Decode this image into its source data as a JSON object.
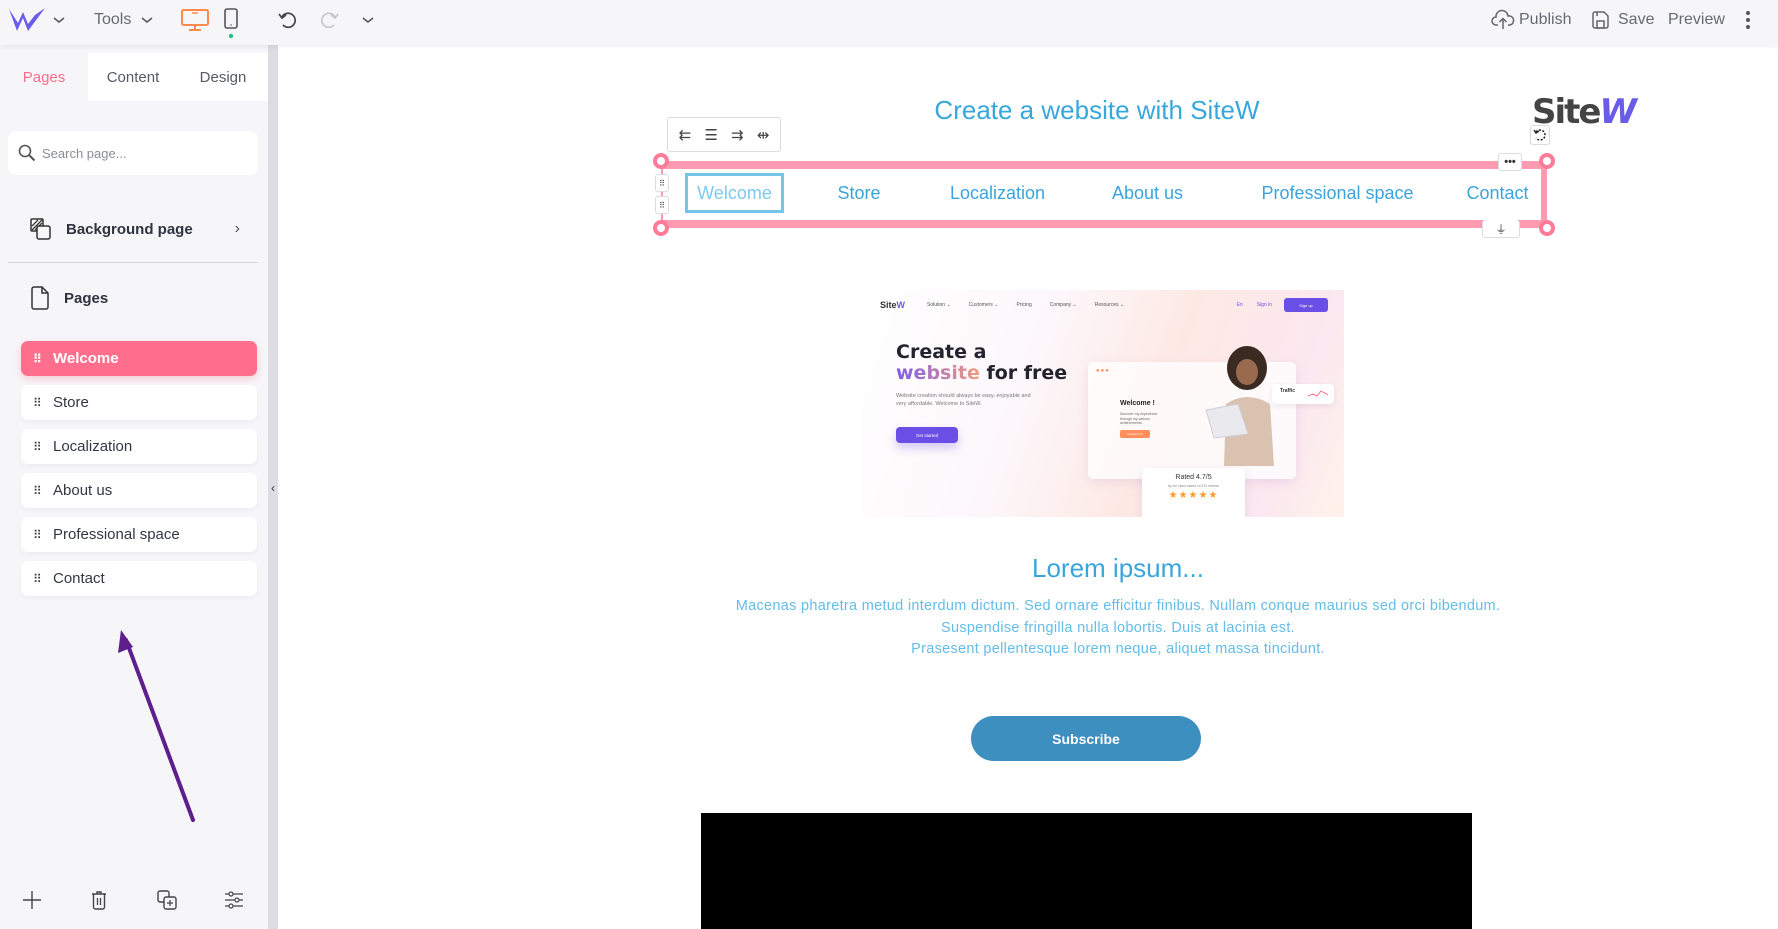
{
  "topbar": {
    "logo_icon": "sitew-w-logo",
    "tools_label": "Tools",
    "publish_label": "Publish",
    "save_label": "Save",
    "preview_label": "Preview",
    "active_device": "desktop",
    "colors": {
      "logo": "#6b5ce7",
      "desktop_active": "#ff8a4c",
      "mobile_dot": "#2dbd7e"
    }
  },
  "sidebar": {
    "tabs": [
      {
        "label": "Pages",
        "active": true
      },
      {
        "label": "Content",
        "active": false
      },
      {
        "label": "Design",
        "active": false
      }
    ],
    "search": {
      "placeholder": "Search page...",
      "value": ""
    },
    "background_page_label": "Background page",
    "pages_section_label": "Pages",
    "pages": [
      {
        "label": "Welcome",
        "active": true
      },
      {
        "label": "Store",
        "active": false
      },
      {
        "label": "Localization",
        "active": false
      },
      {
        "label": "About us",
        "active": false
      },
      {
        "label": "Professional space",
        "active": false
      },
      {
        "label": "Contact",
        "active": false
      }
    ],
    "bottom_tools": [
      "add-page-icon",
      "delete-icon",
      "duplicate-icon",
      "settings-sliders-icon"
    ],
    "accent_color": "#ff6e8c"
  },
  "canvas": {
    "site_title": "Create a website with SiteW",
    "logo_text_site": "Site",
    "logo_text_w": "W",
    "nav_links": [
      {
        "label": "Welcome",
        "active": true
      },
      {
        "label": "Store",
        "active": false
      },
      {
        "label": "Localization",
        "active": false
      },
      {
        "label": "About us",
        "active": false
      },
      {
        "label": "Professional space",
        "active": false
      },
      {
        "label": "Contact",
        "active": false
      }
    ],
    "hero": {
      "logo_site": "Site",
      "logo_w": "W",
      "menu": [
        "Solution ⌄",
        "Customers ⌄",
        "Pricing",
        "Company ⌄",
        "Resources ⌄"
      ],
      "lang": "En",
      "sign_in": "Sign in",
      "sign_up": "Sign up",
      "headline_line1": "Create a",
      "headline_grad": "website",
      "headline_rest": " for free",
      "subtext": "Website creation should always be easy, enjoyable and very affordable. Welcome to SiteW.",
      "cta": "Get started",
      "mock_welcome": "Welcome !",
      "mock_text": "Discover my experience through my various achievements.",
      "mock_button": "Contact me",
      "traffic_label": "Traffic",
      "rating_title": "Rated 4.7/5",
      "rating_sub": "by our users based on 913 reviews",
      "stars": "★★★★★"
    },
    "lorem_title": "Lorem ipsum...",
    "lorem_lines": [
      "Macenas pharetra metud interdum dictum. Sed ornare efficitur finibus. Nullam conque maurius sed orci bibendum.",
      "Suspendise fringilla nulla lobortis. Duis at lacinia est.",
      "Prasesent pellentesque lorem neque, aliquet massa tincidunt."
    ],
    "subscribe_label": "Subscribe",
    "colors": {
      "title": "#38a7dc",
      "body": "#63bde8",
      "button": "#3d8fc0",
      "selection": "#ff9bb0"
    }
  },
  "annotation": {
    "type": "arrow",
    "color": "#5e1f8c",
    "points_to": "area below page list"
  }
}
